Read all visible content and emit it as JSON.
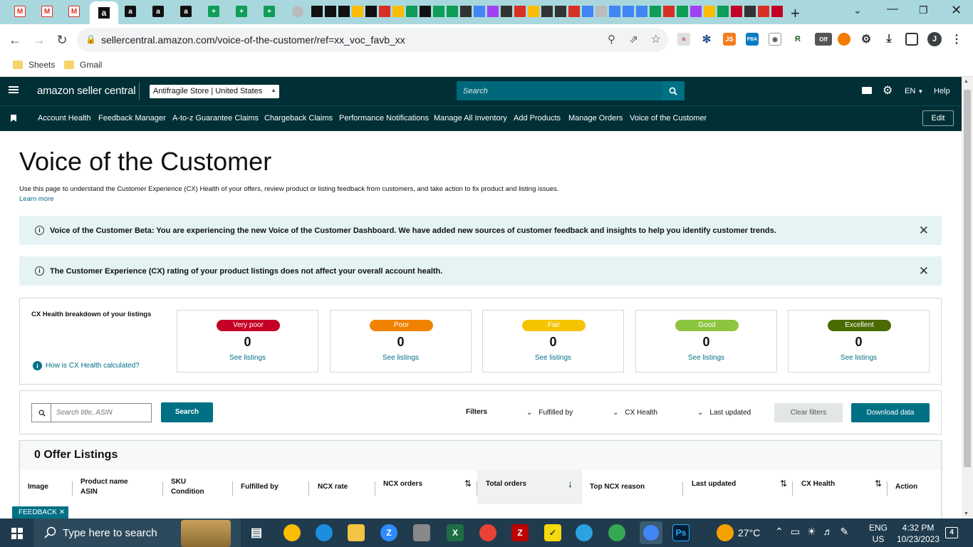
{
  "browser": {
    "url": "sellercentral.amazon.com/voice-of-the-customer/ref=xx_voc_favb_xx",
    "bookmarks": [
      "Sheets",
      "Gmail"
    ],
    "new_tab": "+",
    "profile_initial": "J",
    "ext_badge": "Off",
    "ext_js": "JS",
    "ext_fba": "FBA"
  },
  "header": {
    "logo": "amazon seller central",
    "store": "Antifragile Store | United States",
    "search_placeholder": "Search",
    "language": "EN",
    "help": "Help"
  },
  "nav": {
    "links": [
      "Account Health",
      "Feedback Manager",
      "A-to-z Guarantee Claims",
      "Chargeback Claims",
      "Performance Notifications",
      "Manage All Inventory",
      "Add Products",
      "Manage Orders",
      "Voice of the Customer"
    ],
    "edit": "Edit"
  },
  "page": {
    "title": "Voice of the Customer",
    "description": "Use this page to understand the Customer Experience (CX) Health of your offers, review product or listing feedback from customers, and take action to fix product and listing issues.",
    "learn_more": "Learn more"
  },
  "banners": [
    "Voice of the Customer Beta: You are experiencing the new Voice of the Customer Dashboard. We have added new sources of customer feedback and insights to help you identify customer trends.",
    "The Customer Experience (CX) rating of your product listings does not affect your overall account health."
  ],
  "cx": {
    "heading": "CX Health breakdown of your listings",
    "how_link": "How is CX Health calculated?",
    "categories": [
      {
        "label": "Very poor",
        "count": "0",
        "link": "See listings",
        "color": "#c40026"
      },
      {
        "label": "Poor",
        "count": "0",
        "link": "See listings",
        "color": "#f08200"
      },
      {
        "label": "Fair",
        "count": "0",
        "link": "See listings",
        "color": "#f5c400"
      },
      {
        "label": "Good",
        "count": "0",
        "link": "See listings",
        "color": "#8cc63f"
      },
      {
        "label": "Excellent",
        "count": "0",
        "link": "See listings",
        "color": "#4a6b00"
      }
    ]
  },
  "filters": {
    "search_placeholder": "Search title, ASIN",
    "search_button": "Search",
    "label": "Filters",
    "dropdowns": [
      "Fulfilled by",
      "CX Health",
      "Last updated"
    ],
    "clear": "Clear filters",
    "download": "Download data"
  },
  "listings": {
    "title": "0 Offer Listings",
    "columns": [
      "Image",
      "Product name\nASIN",
      "SKU\nCondition",
      "Fulfilled by",
      "NCX rate",
      "NCX orders",
      "Total orders",
      "Top NCX reason",
      "Last updated",
      "CX Health",
      "Action"
    ]
  },
  "feedback": "FEEDBACK",
  "taskbar": {
    "search_placeholder": "Type here to search",
    "weather": "27°C",
    "lang_top": "ENG",
    "lang_bottom": "US",
    "time": "4:32 PM",
    "date": "10/23/2023",
    "notifications": "4"
  }
}
